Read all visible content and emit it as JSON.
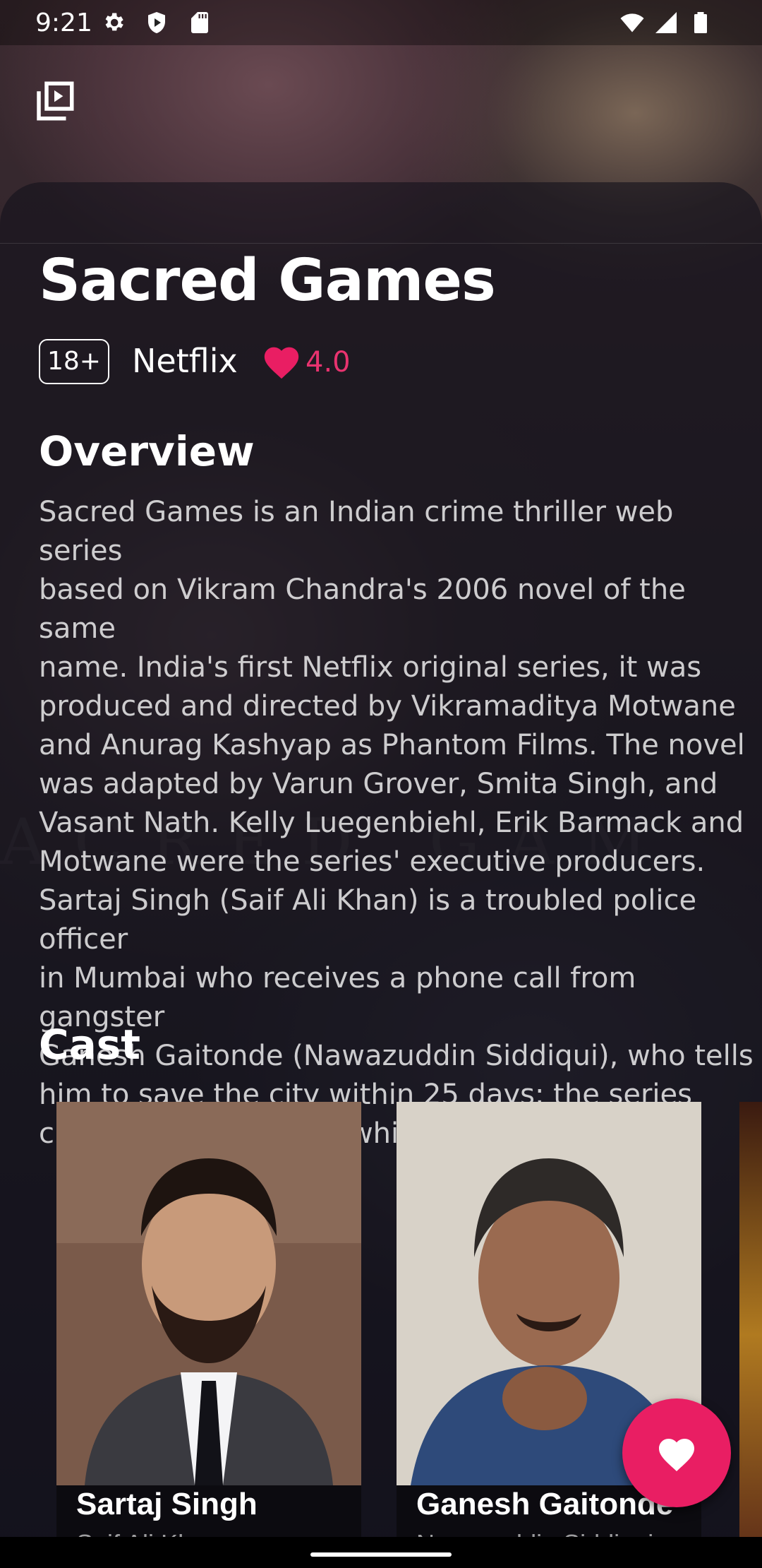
{
  "status_bar": {
    "time": "9:21",
    "icons": [
      "settings-icon",
      "shield-play-icon",
      "sd-card-icon",
      "wifi-icon",
      "signal-icon",
      "battery-icon"
    ]
  },
  "top_bar": {
    "icon": "video-library-icon"
  },
  "show": {
    "title": "Sacred Games",
    "age_rating": "18+",
    "network": "Netflix",
    "rating": "4.0",
    "rating_icon": "heart-icon"
  },
  "overview": {
    "heading": "Overview",
    "text": "Sacred Games is an Indian crime thriller web series\nbased on Vikram Chandra's 2006 novel of the same\nname. India's first Netflix original series, it was\nproduced and directed by Vikramaditya Motwane\nand Anurag Kashyap as Phantom Films. The novel\nwas adapted by Varun Grover, Smita Singh, and\nVasant Nath. Kelly Luegenbiehl, Erik Barmack and\nMotwane were the series' executive producers.\nSartaj Singh (Saif Ali Khan) is a troubled police officer\nin Mumbai who receives a phone call from gangster\nGanesh Gaitonde (Nawazuddin Siddiqui), who tells\nhim to save the city within 25 days; the series\nchronicles the events which follow."
  },
  "cast": {
    "heading": "Cast",
    "members": [
      {
        "name": "Sartaj Singh",
        "role": "Saif Ali Khan"
      },
      {
        "name": "Ganesh Gaitonde",
        "role": "Nawazuddin Siddiqui"
      }
    ]
  },
  "fab": {
    "icon": "heart-icon"
  },
  "colors": {
    "accent": "#e91e63",
    "rating": "#e8336f"
  }
}
